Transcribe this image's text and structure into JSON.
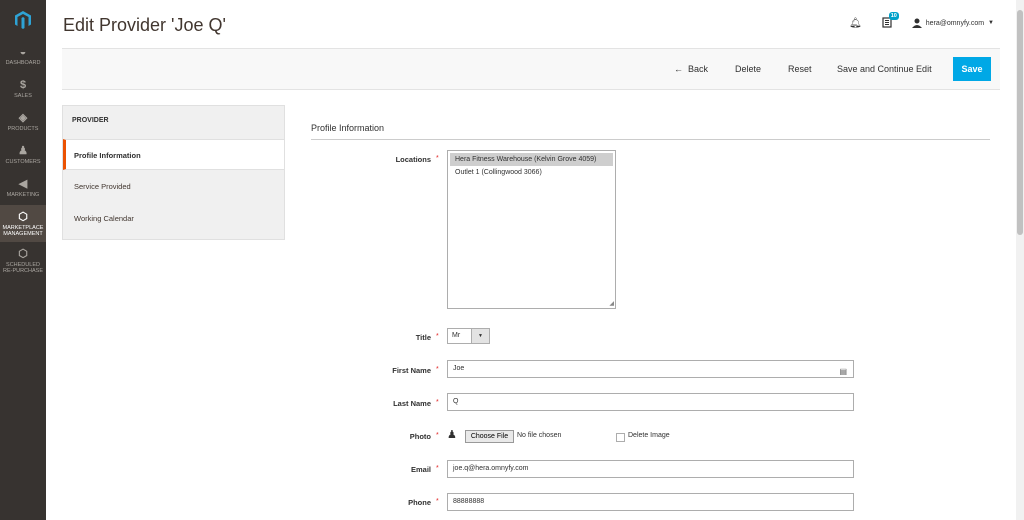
{
  "nav": {
    "items": [
      {
        "label": "DASHBOARD",
        "icon": "dashboard-icon"
      },
      {
        "label": "SALES",
        "icon": "dollar-icon"
      },
      {
        "label": "PRODUCTS",
        "icon": "cube-icon"
      },
      {
        "label": "CUSTOMERS",
        "icon": "person-icon"
      },
      {
        "label": "MARKETING",
        "icon": "megaphone-icon"
      },
      {
        "label1": "MARKETPLACE",
        "label2": "MANAGEMENT",
        "icon": "hexagon-icon"
      },
      {
        "label1": "SCHEDULED",
        "label2": "RE-PURCHASE",
        "icon": "hexagon-icon"
      }
    ]
  },
  "header": {
    "title": "Edit Provider 'Joe Q'",
    "notifications_count": "10",
    "user_email": "hera@omnyfy.com"
  },
  "actions": {
    "back": "Back",
    "delete": "Delete",
    "reset": "Reset",
    "save_continue": "Save and Continue Edit",
    "save": "Save"
  },
  "tabs": {
    "title": "PROVIDER",
    "items": [
      "Profile Information",
      "Service Provided",
      "Working Calendar"
    ]
  },
  "form": {
    "section_title": "Profile Information",
    "locations_label": "Locations",
    "locations_options": [
      "Hera Fitness Warehouse (Kelvin Grove 4059)",
      "Outlet 1 (Collingwood 3066)"
    ],
    "title_label": "Title",
    "title_value": "Mr",
    "first_name_label": "First Name",
    "first_name_value": "Joe",
    "last_name_label": "Last Name",
    "last_name_value": "Q",
    "photo_label": "Photo",
    "choose_file": "Choose File",
    "no_file": "No file chosen",
    "delete_image": "Delete Image",
    "email_label": "Email",
    "email_value": "joe.q@hera.omnyfy.com",
    "phone_label": "Phone",
    "phone_value": "88888888",
    "required_mark": "*"
  },
  "colors": {
    "nav_bg": "#373330",
    "accent_orange": "#eb5202",
    "save_blue": "#00a8e6"
  }
}
